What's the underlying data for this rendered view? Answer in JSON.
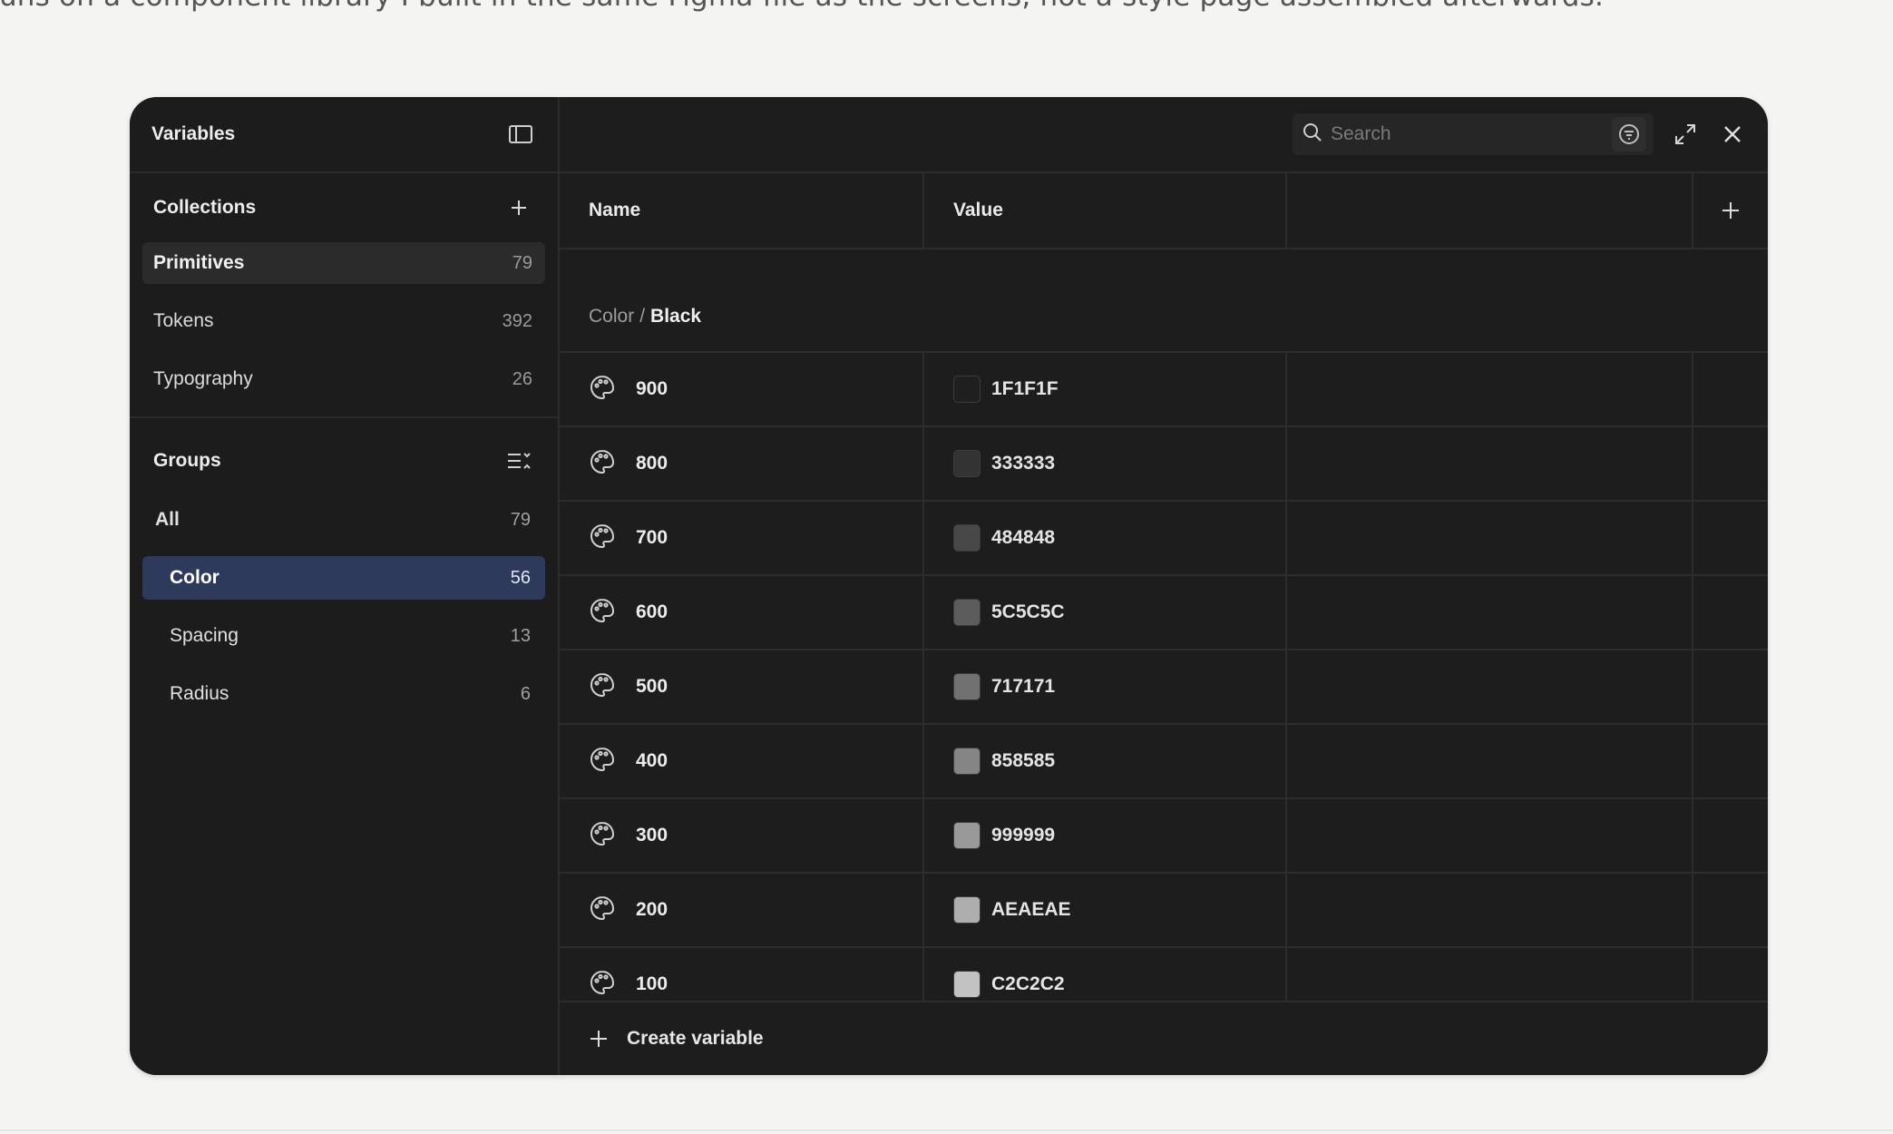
{
  "intro_text": "runs on a component library I built in the same Figma file as the screens, not a style page assembled afterwards.",
  "panel": {
    "title": "Variables",
    "collections": {
      "title": "Collections",
      "items": [
        {
          "label": "Primitives",
          "count": "79",
          "active": true
        },
        {
          "label": "Tokens",
          "count": "392",
          "active": false
        },
        {
          "label": "Typography",
          "count": "26",
          "active": false
        }
      ]
    },
    "groups": {
      "title": "Groups",
      "items": [
        {
          "label": "All",
          "count": "79"
        },
        {
          "label": "Color",
          "count": "56"
        },
        {
          "label": "Spacing",
          "count": "13"
        },
        {
          "label": "Radius",
          "count": "6"
        }
      ]
    }
  },
  "search": {
    "placeholder": "Search"
  },
  "table": {
    "headers": {
      "name": "Name",
      "value": "Value"
    },
    "group_path": {
      "parent": "Color",
      "separator": "/",
      "leaf": "Black"
    },
    "rows": [
      {
        "name": "900",
        "value": "1F1F1F",
        "color": "#1F1F1F"
      },
      {
        "name": "800",
        "value": "333333",
        "color": "#333333"
      },
      {
        "name": "700",
        "value": "484848",
        "color": "#484848"
      },
      {
        "name": "600",
        "value": "5C5C5C",
        "color": "#5C5C5C"
      },
      {
        "name": "500",
        "value": "717171",
        "color": "#717171"
      },
      {
        "name": "400",
        "value": "858585",
        "color": "#858585"
      },
      {
        "name": "300",
        "value": "999999",
        "color": "#999999"
      },
      {
        "name": "200",
        "value": "AEAEAE",
        "color": "#AEAEAE"
      },
      {
        "name": "100",
        "value": "C2C2C2",
        "color": "#C2C2C2"
      }
    ]
  },
  "footer": {
    "create_label": "Create variable"
  },
  "colors": {
    "window_bg": "#1d1d1d",
    "active_group_bg": "#2d3a5c",
    "page_bg": "#f4f4f2"
  }
}
